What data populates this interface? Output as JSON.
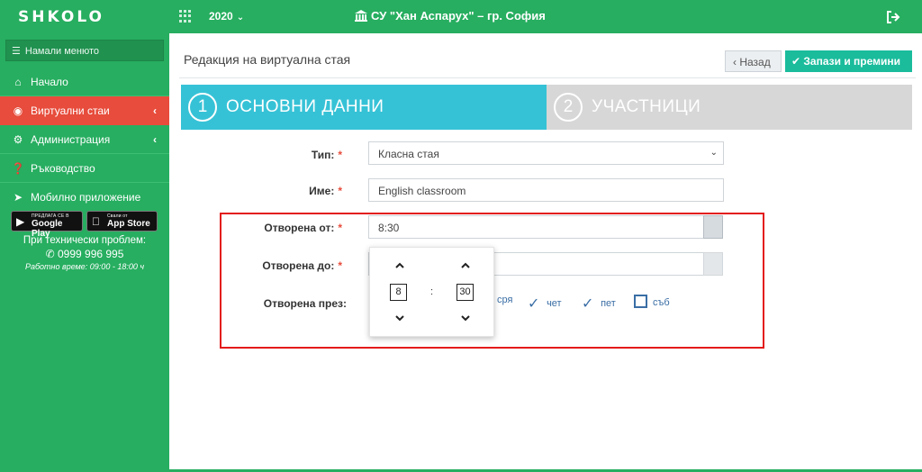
{
  "topbar": {
    "logo": "SHKOLO",
    "year": "2020",
    "school": "СУ \"Хан Аспарух\" – гр. София"
  },
  "sidebar": {
    "collapse_label": "Намали менюто",
    "items": [
      {
        "label": "Начало",
        "icon": "home-icon"
      },
      {
        "label": "Виртуални стаи",
        "icon": "webcam-icon"
      },
      {
        "label": "Администрация",
        "icon": "gears-icon"
      },
      {
        "label": "Ръководство",
        "icon": "question-icon"
      },
      {
        "label": "Мобилно приложение",
        "icon": "rocket-icon"
      }
    ],
    "google_play": {
      "small": "ПРЕДЛАГА СЕ В",
      "big": "Google Play"
    },
    "app_store": {
      "small": "Свали от",
      "big": "App Store"
    },
    "support_text": "При технически проблем:",
    "phone": "0999 996 995",
    "hours": "Работно време: 09:00 - 18:00 ч"
  },
  "page": {
    "title": "Редакция на виртуална стая",
    "back_label": "Назад",
    "save_label": "Запази и премини"
  },
  "steps": [
    {
      "number": "1",
      "label": "ОСНОВНИ ДАННИ"
    },
    {
      "number": "2",
      "label": "УЧАСТНИЦИ"
    }
  ],
  "form": {
    "type_label": "Тип:",
    "type_value": "Класна стая",
    "name_label": "Име:",
    "name_value": "English classroom",
    "open_from_label": "Отворена от:",
    "open_from_value": "8:30",
    "open_to_label": "Отворена до:",
    "open_to_value": "",
    "open_days_label": "Отворена през:",
    "required_mark": "*",
    "days": [
      {
        "label": "сря",
        "checked": true
      },
      {
        "label": "чет",
        "checked": true
      },
      {
        "label": "пет",
        "checked": true
      },
      {
        "label": "съб",
        "checked": false
      }
    ]
  },
  "timepicker": {
    "hour": "8",
    "minute": "30",
    "separator": ":"
  },
  "colors": {
    "brand_green": "#27ae60",
    "active_red": "#e74c3c",
    "step_active": "#36c2d6",
    "step_inactive": "#d7d7d7",
    "save_button": "#1abc9c",
    "highlight_box": "#e31b1b"
  }
}
